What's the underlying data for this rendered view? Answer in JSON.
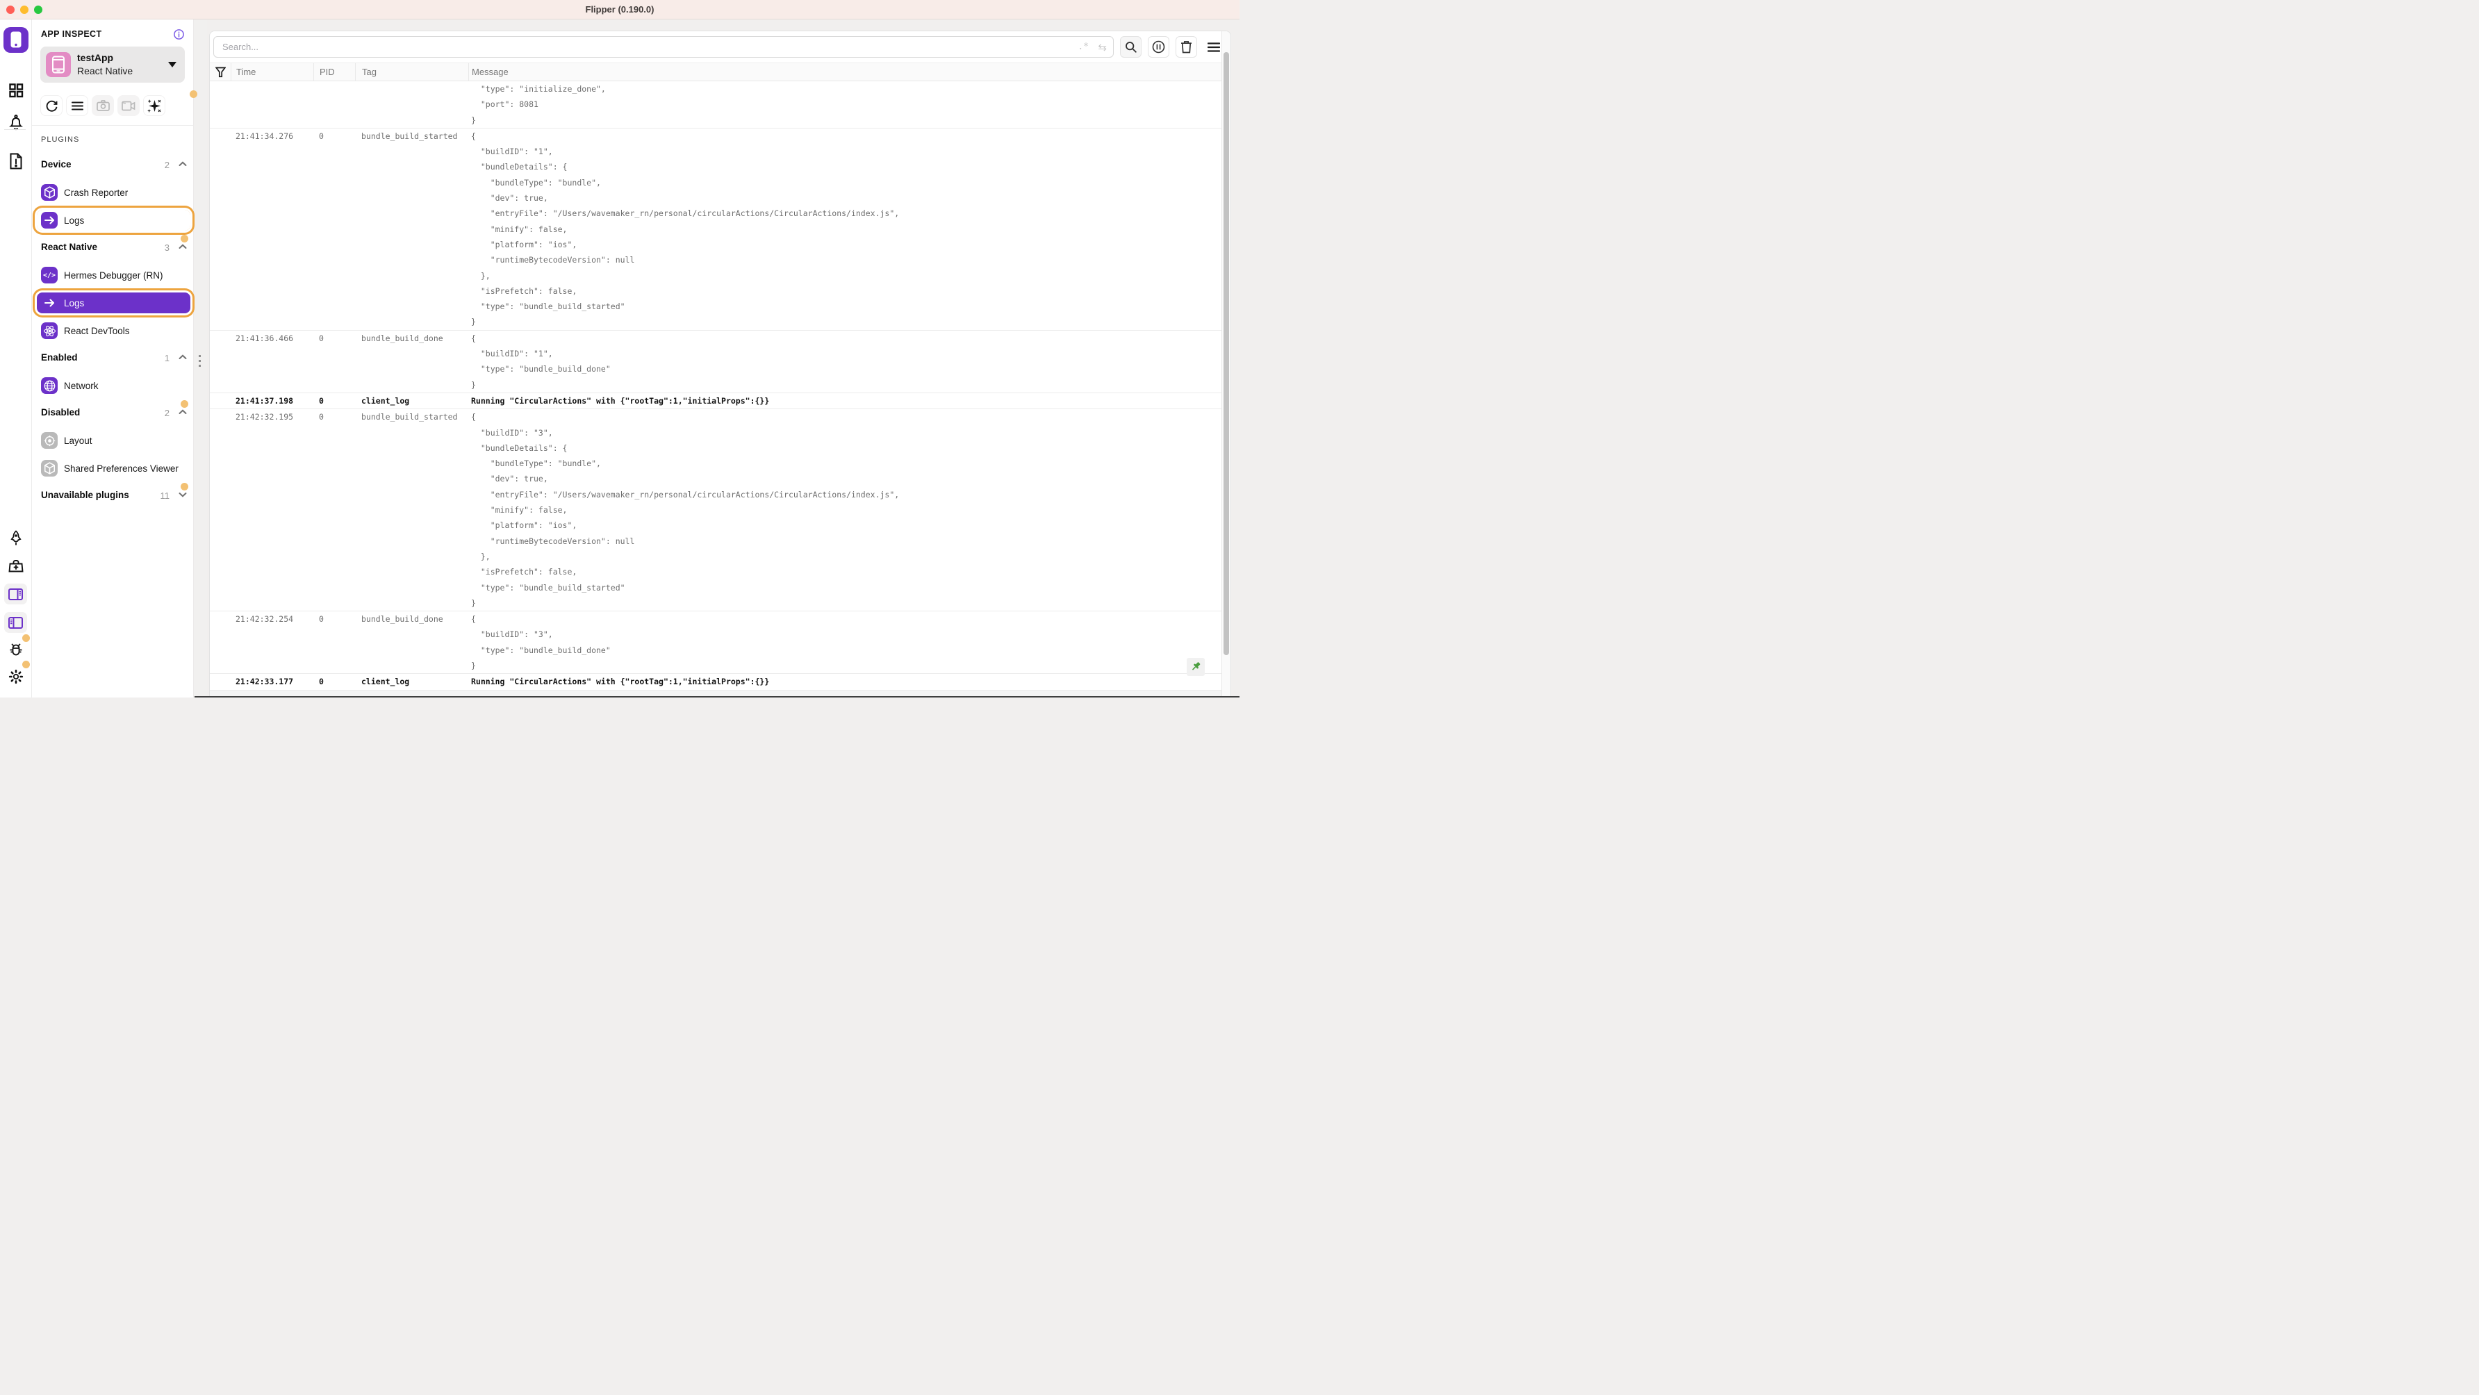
{
  "window": {
    "title": "Flipper (0.190.0)"
  },
  "colors": {
    "accent_purple": "#6c31c9",
    "highlight_orange": "#eda43f",
    "notification_dot": "#f3c173",
    "pin_green": "#4a9e3f",
    "titlebar_pink": "#f8ece8"
  },
  "sidebar": {
    "section_label": "APP INSPECT",
    "app": {
      "name": "testApp",
      "platform": "React Native"
    },
    "plugins_label": "PLUGINS",
    "groups": [
      {
        "label": "Device",
        "count": "2",
        "chevron": "up",
        "dot": false,
        "items": [
          {
            "label": "Crash Reporter",
            "icon": "cube",
            "state": "normal",
            "ringed": false
          },
          {
            "label": "Logs",
            "icon": "arrow",
            "state": "normal",
            "ringed": true
          }
        ]
      },
      {
        "label": "React Native",
        "count": "3",
        "chevron": "up",
        "dot": true,
        "items": [
          {
            "label": "Hermes Debugger (RN)",
            "icon": "code",
            "state": "normal",
            "ringed": false
          },
          {
            "label": "Logs",
            "icon": "arrow",
            "state": "selected",
            "ringed": true
          },
          {
            "label": "React DevTools",
            "icon": "atom",
            "state": "normal",
            "ringed": false
          }
        ]
      },
      {
        "label": "Enabled",
        "count": "1",
        "chevron": "up",
        "dot": false,
        "items": [
          {
            "label": "Network",
            "icon": "globe",
            "state": "normal",
            "ringed": false
          }
        ]
      },
      {
        "label": "Disabled",
        "count": "2",
        "chevron": "up",
        "dot": true,
        "items": [
          {
            "label": "Layout",
            "icon": "target",
            "state": "disabled",
            "ringed": false
          },
          {
            "label": "Shared Preferences Viewer",
            "icon": "cube",
            "state": "disabled",
            "ringed": false
          }
        ]
      },
      {
        "label": "Unavailable plugins",
        "count": "11",
        "chevron": "down",
        "dot": true,
        "items": []
      }
    ]
  },
  "toolbar": {
    "search_placeholder": "Search...",
    "regex_icon_label": ".*",
    "swap_icon_label": "⇆"
  },
  "table": {
    "columns": [
      "Time",
      "PID",
      "Tag",
      "Message"
    ],
    "rows": [
      {
        "time": "",
        "pid": "",
        "tag": "",
        "bold": false,
        "message_lines": [
          "  \"type\": \"initialize_done\",",
          "  \"port\": 8081",
          "}"
        ]
      },
      {
        "time": "21:41:34.276",
        "pid": "0",
        "tag": "bundle_build_started",
        "bold": false,
        "message_lines": [
          "{",
          "  \"buildID\": \"1\",",
          "  \"bundleDetails\": {",
          "    \"bundleType\": \"bundle\",",
          "    \"dev\": true,",
          "    \"entryFile\": \"/Users/wavemaker_rn/personal/circularActions/CircularActions/index.js\",",
          "    \"minify\": false,",
          "    \"platform\": \"ios\",",
          "    \"runtimeBytecodeVersion\": null",
          "  },",
          "  \"isPrefetch\": false,",
          "  \"type\": \"bundle_build_started\"",
          "}"
        ]
      },
      {
        "time": "21:41:36.466",
        "pid": "0",
        "tag": "bundle_build_done",
        "bold": false,
        "message_lines": [
          "{",
          "  \"buildID\": \"1\",",
          "  \"type\": \"bundle_build_done\"",
          "}"
        ]
      },
      {
        "time": "21:41:37.198",
        "pid": "0",
        "tag": "client_log",
        "bold": true,
        "message_lines": [
          "Running \"CircularActions\" with {\"rootTag\":1,\"initialProps\":{}}"
        ]
      },
      {
        "time": "21:42:32.195",
        "pid": "0",
        "tag": "bundle_build_started",
        "bold": false,
        "message_lines": [
          "{",
          "  \"buildID\": \"3\",",
          "  \"bundleDetails\": {",
          "    \"bundleType\": \"bundle\",",
          "    \"dev\": true,",
          "    \"entryFile\": \"/Users/wavemaker_rn/personal/circularActions/CircularActions/index.js\",",
          "    \"minify\": false,",
          "    \"platform\": \"ios\",",
          "    \"runtimeBytecodeVersion\": null",
          "  },",
          "  \"isPrefetch\": false,",
          "  \"type\": \"bundle_build_started\"",
          "}"
        ]
      },
      {
        "time": "21:42:32.254",
        "pid": "0",
        "tag": "bundle_build_done",
        "bold": false,
        "message_lines": [
          "{",
          "  \"buildID\": \"3\",",
          "  \"type\": \"bundle_build_done\"",
          "}"
        ]
      },
      {
        "time": "21:42:33.177",
        "pid": "0",
        "tag": "client_log",
        "bold": true,
        "message_lines": [
          "Running \"CircularActions\" with {\"rootTag\":1,\"initialProps\":{}}"
        ]
      }
    ]
  }
}
